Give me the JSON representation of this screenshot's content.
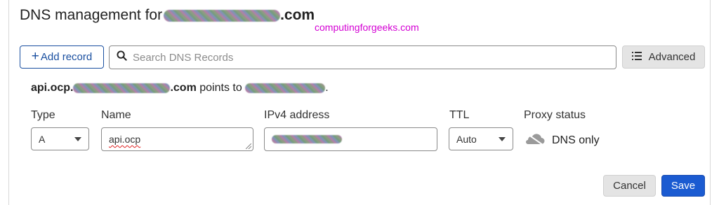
{
  "header": {
    "title_prefix": "DNS management for",
    "title_suffix": ".com",
    "watermark": "computingforgeeks.com"
  },
  "toolbar": {
    "add_record_label": "Add record",
    "search_placeholder": "Search DNS Records",
    "advanced_label": "Advanced"
  },
  "record": {
    "host_prefix": "api.ocp.",
    "host_suffix": ".com",
    "points_to_text": "points to",
    "trailing": "."
  },
  "form": {
    "type": {
      "label": "Type",
      "value": "A"
    },
    "name": {
      "label": "Name",
      "value": "api.ocp"
    },
    "ipv4": {
      "label": "IPv4 address",
      "value": ""
    },
    "ttl": {
      "label": "TTL",
      "value": "Auto"
    },
    "proxy": {
      "label": "Proxy status",
      "value": "DNS only",
      "icon": "cloud-icon"
    }
  },
  "actions": {
    "cancel_label": "Cancel",
    "save_label": "Save"
  },
  "colors": {
    "primary": "#1b5bd1",
    "outline_blue": "#1a4fa0",
    "watermark": "#d400d4"
  }
}
